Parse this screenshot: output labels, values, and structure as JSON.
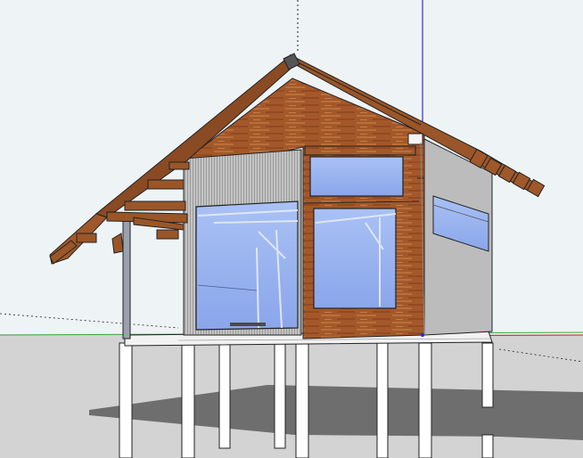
{
  "app": {
    "viewport_label": ""
  },
  "colors": {
    "sky": "#eef3f6",
    "ground": "#d2d2d2",
    "shadow": "#6e6e6e",
    "wood_siding": "#a4582a",
    "wood_light": "#c27a42",
    "roof_sheet": "#8a4a23",
    "metal_panel": "#b8b8b8",
    "glass": "#9ab4f2",
    "post": "#ffffff",
    "outline": "#1a1a1a",
    "axis_red": "#cc2a2a",
    "axis_green": "#3aa63a",
    "axis_blue": "#2a2adc"
  },
  "model": {
    "icons": [
      "axis-origin-icon"
    ]
  }
}
